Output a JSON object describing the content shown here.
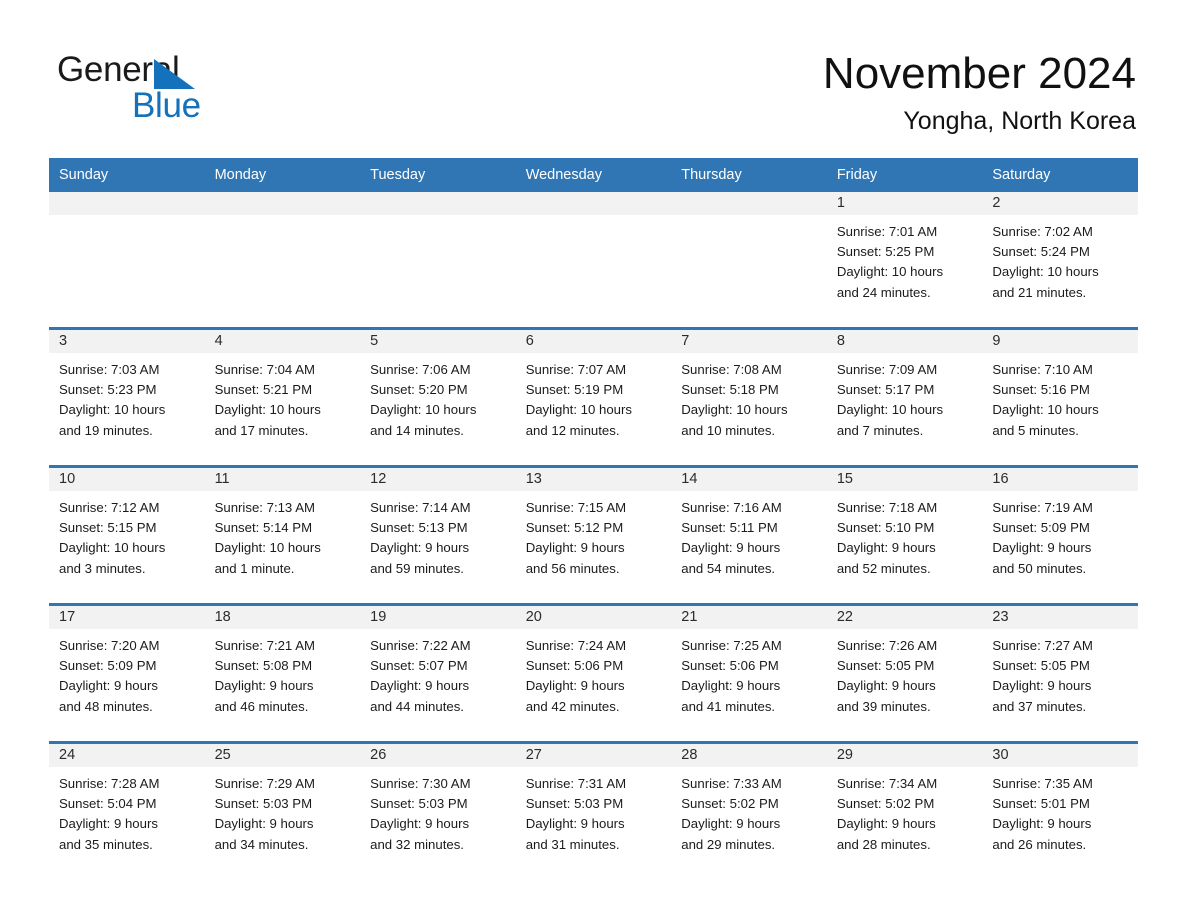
{
  "brand": {
    "name_part1": "General",
    "name_part2": "Blue",
    "triangle_color": "#1372bb"
  },
  "header": {
    "month_title": "November 2024",
    "location": "Yongha, North Korea"
  },
  "theme": {
    "header_blue": "#3075b4",
    "daynum_bg": "#f2f2f2",
    "row_divider": "#3075b4"
  },
  "calendar": {
    "weekdays": [
      "Sunday",
      "Monday",
      "Tuesday",
      "Wednesday",
      "Thursday",
      "Friday",
      "Saturday"
    ],
    "weeks": [
      [
        {
          "day": "",
          "lines": []
        },
        {
          "day": "",
          "lines": []
        },
        {
          "day": "",
          "lines": []
        },
        {
          "day": "",
          "lines": []
        },
        {
          "day": "",
          "lines": []
        },
        {
          "day": "1",
          "lines": [
            "Sunrise: 7:01 AM",
            "Sunset: 5:25 PM",
            "Daylight: 10 hours",
            "and 24 minutes."
          ]
        },
        {
          "day": "2",
          "lines": [
            "Sunrise: 7:02 AM",
            "Sunset: 5:24 PM",
            "Daylight: 10 hours",
            "and 21 minutes."
          ]
        }
      ],
      [
        {
          "day": "3",
          "lines": [
            "Sunrise: 7:03 AM",
            "Sunset: 5:23 PM",
            "Daylight: 10 hours",
            "and 19 minutes."
          ]
        },
        {
          "day": "4",
          "lines": [
            "Sunrise: 7:04 AM",
            "Sunset: 5:21 PM",
            "Daylight: 10 hours",
            "and 17 minutes."
          ]
        },
        {
          "day": "5",
          "lines": [
            "Sunrise: 7:06 AM",
            "Sunset: 5:20 PM",
            "Daylight: 10 hours",
            "and 14 minutes."
          ]
        },
        {
          "day": "6",
          "lines": [
            "Sunrise: 7:07 AM",
            "Sunset: 5:19 PM",
            "Daylight: 10 hours",
            "and 12 minutes."
          ]
        },
        {
          "day": "7",
          "lines": [
            "Sunrise: 7:08 AM",
            "Sunset: 5:18 PM",
            "Daylight: 10 hours",
            "and 10 minutes."
          ]
        },
        {
          "day": "8",
          "lines": [
            "Sunrise: 7:09 AM",
            "Sunset: 5:17 PM",
            "Daylight: 10 hours",
            "and 7 minutes."
          ]
        },
        {
          "day": "9",
          "lines": [
            "Sunrise: 7:10 AM",
            "Sunset: 5:16 PM",
            "Daylight: 10 hours",
            "and 5 minutes."
          ]
        }
      ],
      [
        {
          "day": "10",
          "lines": [
            "Sunrise: 7:12 AM",
            "Sunset: 5:15 PM",
            "Daylight: 10 hours",
            "and 3 minutes."
          ]
        },
        {
          "day": "11",
          "lines": [
            "Sunrise: 7:13 AM",
            "Sunset: 5:14 PM",
            "Daylight: 10 hours",
            "and 1 minute."
          ]
        },
        {
          "day": "12",
          "lines": [
            "Sunrise: 7:14 AM",
            "Sunset: 5:13 PM",
            "Daylight: 9 hours",
            "and 59 minutes."
          ]
        },
        {
          "day": "13",
          "lines": [
            "Sunrise: 7:15 AM",
            "Sunset: 5:12 PM",
            "Daylight: 9 hours",
            "and 56 minutes."
          ]
        },
        {
          "day": "14",
          "lines": [
            "Sunrise: 7:16 AM",
            "Sunset: 5:11 PM",
            "Daylight: 9 hours",
            "and 54 minutes."
          ]
        },
        {
          "day": "15",
          "lines": [
            "Sunrise: 7:18 AM",
            "Sunset: 5:10 PM",
            "Daylight: 9 hours",
            "and 52 minutes."
          ]
        },
        {
          "day": "16",
          "lines": [
            "Sunrise: 7:19 AM",
            "Sunset: 5:09 PM",
            "Daylight: 9 hours",
            "and 50 minutes."
          ]
        }
      ],
      [
        {
          "day": "17",
          "lines": [
            "Sunrise: 7:20 AM",
            "Sunset: 5:09 PM",
            "Daylight: 9 hours",
            "and 48 minutes."
          ]
        },
        {
          "day": "18",
          "lines": [
            "Sunrise: 7:21 AM",
            "Sunset: 5:08 PM",
            "Daylight: 9 hours",
            "and 46 minutes."
          ]
        },
        {
          "day": "19",
          "lines": [
            "Sunrise: 7:22 AM",
            "Sunset: 5:07 PM",
            "Daylight: 9 hours",
            "and 44 minutes."
          ]
        },
        {
          "day": "20",
          "lines": [
            "Sunrise: 7:24 AM",
            "Sunset: 5:06 PM",
            "Daylight: 9 hours",
            "and 42 minutes."
          ]
        },
        {
          "day": "21",
          "lines": [
            "Sunrise: 7:25 AM",
            "Sunset: 5:06 PM",
            "Daylight: 9 hours",
            "and 41 minutes."
          ]
        },
        {
          "day": "22",
          "lines": [
            "Sunrise: 7:26 AM",
            "Sunset: 5:05 PM",
            "Daylight: 9 hours",
            "and 39 minutes."
          ]
        },
        {
          "day": "23",
          "lines": [
            "Sunrise: 7:27 AM",
            "Sunset: 5:05 PM",
            "Daylight: 9 hours",
            "and 37 minutes."
          ]
        }
      ],
      [
        {
          "day": "24",
          "lines": [
            "Sunrise: 7:28 AM",
            "Sunset: 5:04 PM",
            "Daylight: 9 hours",
            "and 35 minutes."
          ]
        },
        {
          "day": "25",
          "lines": [
            "Sunrise: 7:29 AM",
            "Sunset: 5:03 PM",
            "Daylight: 9 hours",
            "and 34 minutes."
          ]
        },
        {
          "day": "26",
          "lines": [
            "Sunrise: 7:30 AM",
            "Sunset: 5:03 PM",
            "Daylight: 9 hours",
            "and 32 minutes."
          ]
        },
        {
          "day": "27",
          "lines": [
            "Sunrise: 7:31 AM",
            "Sunset: 5:03 PM",
            "Daylight: 9 hours",
            "and 31 minutes."
          ]
        },
        {
          "day": "28",
          "lines": [
            "Sunrise: 7:33 AM",
            "Sunset: 5:02 PM",
            "Daylight: 9 hours",
            "and 29 minutes."
          ]
        },
        {
          "day": "29",
          "lines": [
            "Sunrise: 7:34 AM",
            "Sunset: 5:02 PM",
            "Daylight: 9 hours",
            "and 28 minutes."
          ]
        },
        {
          "day": "30",
          "lines": [
            "Sunrise: 7:35 AM",
            "Sunset: 5:01 PM",
            "Daylight: 9 hours",
            "and 26 minutes."
          ]
        }
      ]
    ]
  }
}
